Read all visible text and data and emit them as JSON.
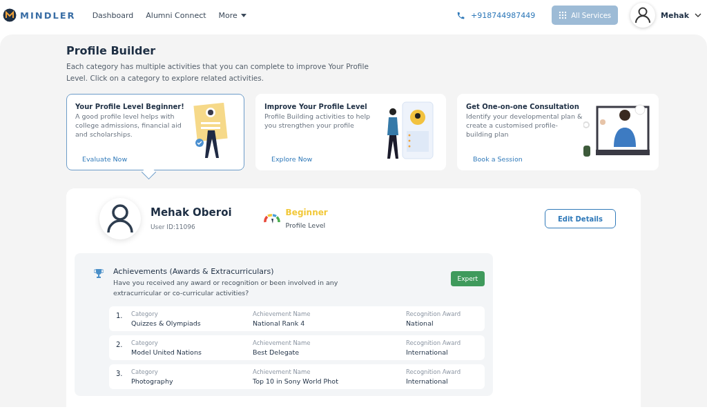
{
  "header": {
    "logo": "MINDLER",
    "nav": [
      {
        "label": "Dashboard"
      },
      {
        "label": "Alumni Connect"
      },
      {
        "label": "More",
        "dropdown": true
      }
    ],
    "phone": "+918744987449",
    "services": {
      "label": "All Services",
      "disabled": true
    },
    "user": "Mehak"
  },
  "intro": {
    "title": "Profile Builder",
    "description": "Each category has multiple activities that you can complete to improve Your Profile Level. Click on a category to explore related activities."
  },
  "cards": [
    {
      "title": "Your Profile Level Beginner!",
      "text": "A good profile level helps with college admissions, financial aid and scholarships.",
      "action": "Evaluate Now",
      "selected": true
    },
    {
      "title": "Improve Your Profile Level",
      "text": "Profile Building activities to help you strengthen your profile",
      "action": "Explore Now",
      "selected": false
    },
    {
      "title": "Get One-on-one Consultation",
      "text": "Identify your developmental plan & create a customised profile-building plan",
      "action": "Book a Session",
      "selected": false
    }
  ],
  "profile": {
    "name": "Mehak Oberoi",
    "user_id": "User ID:11096",
    "level": "Beginner",
    "level_label": "Profile Level",
    "edit": "Edit Details"
  },
  "achievements": {
    "title": "Achievements (Awards & Extracurriculars)",
    "question": "Have you received any award or recognition or been involved in any extracurricular or co-curricular activities?",
    "badge": "Expert",
    "rows": [
      {
        "number": "1.",
        "fields": [
          {
            "label": "Category",
            "value": "Quizzes & Olympiads"
          },
          {
            "label": "Achievement Name",
            "value": "National Rank 4"
          },
          {
            "label": "Recognition Award",
            "value": "National"
          }
        ]
      },
      {
        "number": "2.",
        "fields": [
          {
            "label": "Category",
            "value": "Model United Nations"
          },
          {
            "label": "Achievement Name",
            "value": "Best Delegate"
          },
          {
            "label": "Recognition Award",
            "value": "International"
          }
        ]
      },
      {
        "number": "3.",
        "fields": [
          {
            "label": "Category",
            "value": "Photography"
          },
          {
            "label": "Achievement Name",
            "value": "Top 10 in Sony World Phot"
          },
          {
            "label": "Recognition Award",
            "value": "International"
          }
        ]
      }
    ]
  }
}
